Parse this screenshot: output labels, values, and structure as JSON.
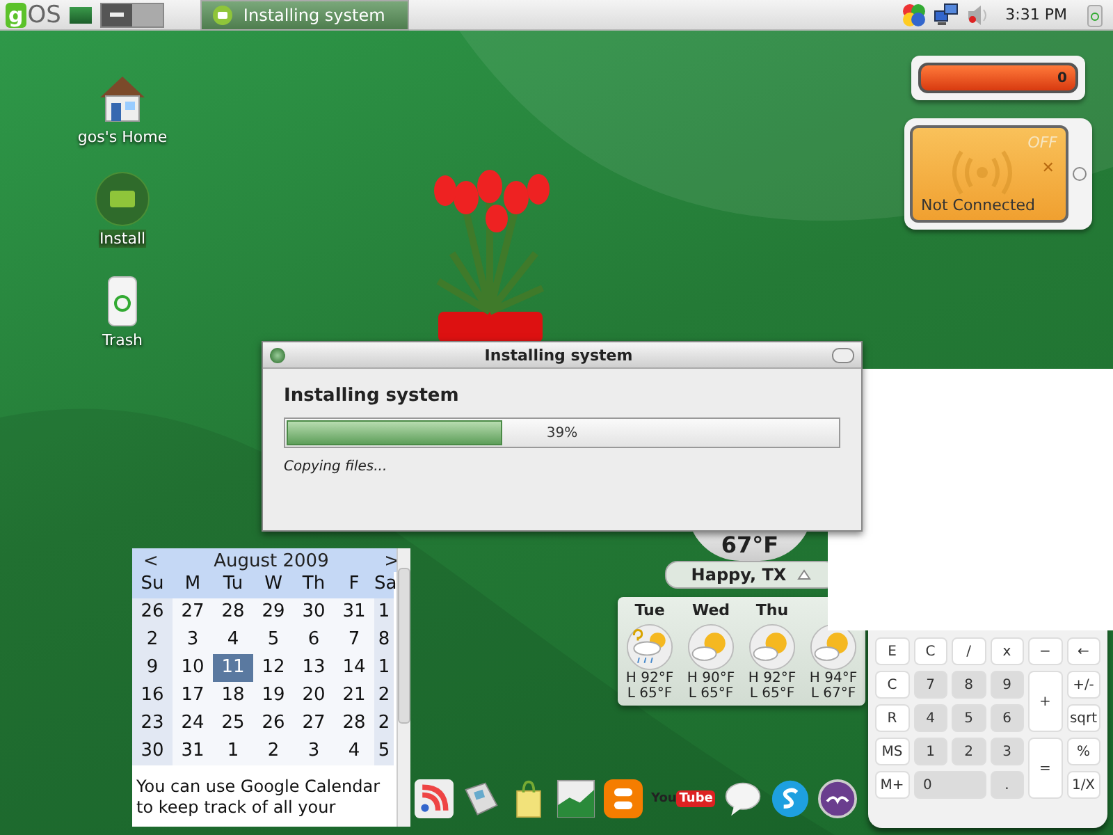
{
  "panel": {
    "logo": {
      "letter": "g",
      "text": "OS"
    },
    "workspaces": [
      {
        "selected": true
      },
      {
        "selected": false
      }
    ],
    "tasks": [
      {
        "label": "Installing system",
        "selected": true
      }
    ],
    "tray": [
      {
        "kind": "apps"
      },
      {
        "kind": "network"
      },
      {
        "kind": "volume"
      }
    ],
    "clock": "3:31 PM"
  },
  "desktop_icons": [
    {
      "kind": "home",
      "label": "gos's Home",
      "selected": false
    },
    {
      "kind": "install",
      "label": "Install",
      "selected": true
    },
    {
      "kind": "trash",
      "label": "Trash",
      "selected": false
    }
  ],
  "meter_widget": {
    "value": "0"
  },
  "wifi_widget": {
    "state": "OFF",
    "close": "✕",
    "status": "Not Connected"
  },
  "dialog": {
    "title": "Installing system",
    "heading": "Installing system",
    "progress": {
      "level": 0.39,
      "text": "39%"
    },
    "status": "Copying files..."
  },
  "weather": {
    "temperature": "67°F",
    "location": "Happy, TX",
    "days": [
      {
        "day": "Tue",
        "kind": "storm",
        "high": "H 92°F",
        "low": "L 65°F"
      },
      {
        "day": "Wed",
        "kind": "partly",
        "high": "H 90°F",
        "low": "L 65°F"
      },
      {
        "day": "Thu",
        "kind": "partly",
        "high": "H 92°F",
        "low": "L 65°F"
      },
      {
        "kind": "partly",
        "high": "H 94°F",
        "low": "L 67°F"
      }
    ]
  },
  "calendar": {
    "prev": "<",
    "month": "August 2009",
    "next": ">",
    "weekdays": [
      "Su",
      "M",
      "Tu",
      "W",
      "Th",
      "F",
      "Sa"
    ],
    "weeks": [
      [
        {
          "d": "26",
          "selected": false
        },
        {
          "d": "27",
          "selected": false
        },
        {
          "d": "28",
          "selected": false
        },
        {
          "d": "29",
          "selected": false
        },
        {
          "d": "30",
          "selected": false
        },
        {
          "d": "31",
          "selected": false
        },
        {
          "d": "1",
          "selected": false
        }
      ],
      [
        {
          "d": "2",
          "selected": false
        },
        {
          "d": "3",
          "selected": false
        },
        {
          "d": "4",
          "selected": false
        },
        {
          "d": "5",
          "selected": false
        },
        {
          "d": "6",
          "selected": false
        },
        {
          "d": "7",
          "selected": false
        },
        {
          "d": "8",
          "selected": false
        }
      ],
      [
        {
          "d": "9",
          "selected": false
        },
        {
          "d": "10",
          "selected": false
        },
        {
          "d": "11",
          "selected": true
        },
        {
          "d": "12",
          "selected": false
        },
        {
          "d": "13",
          "selected": false
        },
        {
          "d": "14",
          "selected": false
        },
        {
          "d": "1",
          "selected": false
        }
      ],
      [
        {
          "d": "16",
          "selected": false
        },
        {
          "d": "17",
          "selected": false
        },
        {
          "d": "18",
          "selected": false
        },
        {
          "d": "19",
          "selected": false
        },
        {
          "d": "20",
          "selected": false
        },
        {
          "d": "21",
          "selected": false
        },
        {
          "d": "2",
          "selected": false
        }
      ],
      [
        {
          "d": "23",
          "selected": false
        },
        {
          "d": "24",
          "selected": false
        },
        {
          "d": "25",
          "selected": false
        },
        {
          "d": "26",
          "selected": false
        },
        {
          "d": "27",
          "selected": false
        },
        {
          "d": "28",
          "selected": false
        },
        {
          "d": "2",
          "selected": false
        }
      ],
      [
        {
          "d": "30",
          "selected": false
        },
        {
          "d": "31",
          "selected": false
        },
        {
          "d": "1",
          "selected": false
        },
        {
          "d": "2",
          "selected": false
        },
        {
          "d": "3",
          "selected": false
        },
        {
          "d": "4",
          "selected": false
        },
        {
          "d": "5",
          "selected": false
        }
      ]
    ],
    "note": "You can use Google Calendar to keep track of all your"
  },
  "calculator": {
    "keys": [
      {
        "text": "E",
        "kind": "key"
      },
      {
        "text": "C",
        "kind": "key"
      },
      {
        "text": "/",
        "kind": "key"
      },
      {
        "text": "x",
        "kind": "key"
      },
      {
        "text": "−",
        "kind": "key"
      },
      {
        "text": "←",
        "kind": "key"
      },
      {
        "text": "C",
        "kind": "key"
      },
      {
        "text": "7",
        "kind": "digit"
      },
      {
        "text": "8",
        "kind": "digit"
      },
      {
        "text": "9",
        "kind": "digit"
      },
      {
        "text": "+",
        "kind": "tall_key"
      },
      {
        "text": "+/-",
        "kind": "key"
      },
      {
        "text": "R",
        "kind": "key"
      },
      {
        "text": "4",
        "kind": "digit"
      },
      {
        "text": "5",
        "kind": "digit"
      },
      {
        "text": "6",
        "kind": "digit"
      },
      {
        "text": "sqrt",
        "kind": "key"
      },
      {
        "text": "MS",
        "kind": "key"
      },
      {
        "text": "1",
        "kind": "digit"
      },
      {
        "text": "2",
        "kind": "digit"
      },
      {
        "text": "3",
        "kind": "digit"
      },
      {
        "text": "=",
        "kind": "tall_key"
      },
      {
        "text": "%",
        "kind": "key"
      },
      {
        "text": "M+",
        "kind": "key"
      },
      {
        "text": "0",
        "kind": "wide_digit"
      },
      {
        "text": ".",
        "kind": "digit"
      },
      {
        "text": "1/X",
        "kind": "key"
      }
    ]
  },
  "dock": [
    {
      "kind": "rss"
    },
    {
      "kind": "news"
    },
    {
      "kind": "bag"
    },
    {
      "kind": "chart"
    },
    {
      "kind": "blog"
    },
    {
      "kind": "video",
      "texts": [
        "You",
        "Tube"
      ]
    },
    {
      "kind": "chat"
    },
    {
      "kind": "phone"
    },
    {
      "kind": "office"
    }
  ]
}
